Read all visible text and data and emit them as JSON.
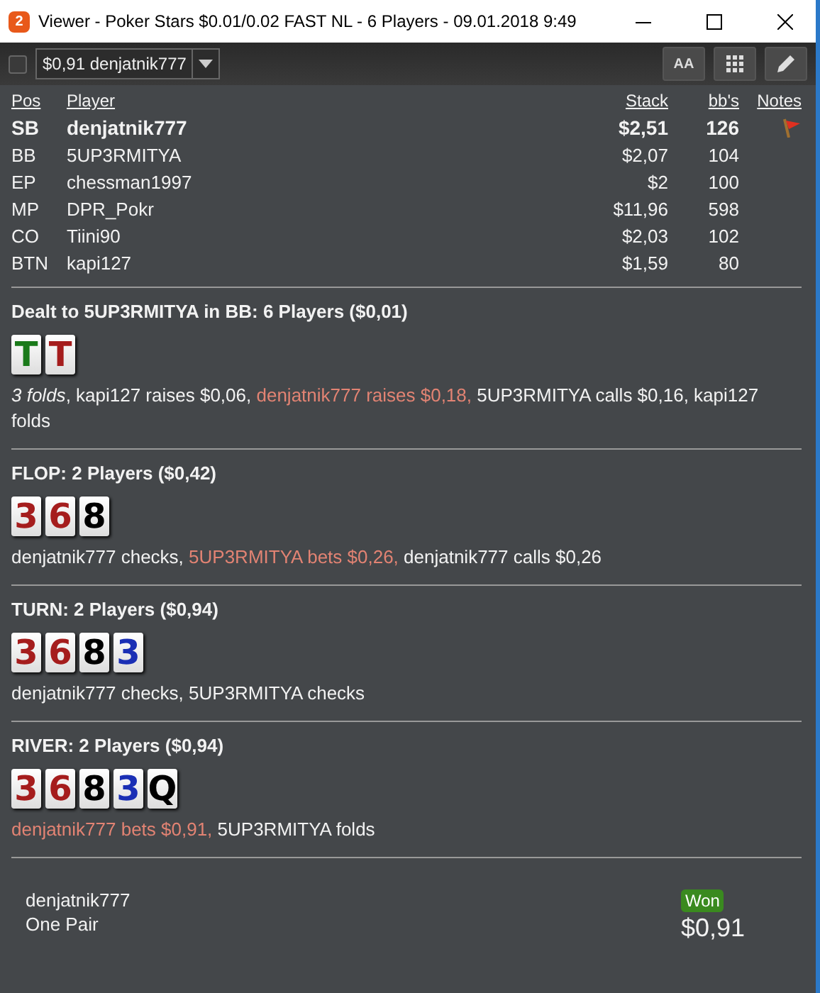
{
  "window": {
    "title": "Viewer - Poker Stars $0.01/0.02 FAST NL - 6 Players - 09.01.2018 9:49",
    "app_badge": "2"
  },
  "toolbar": {
    "checkbox": {
      "checked": false
    },
    "hand_select": {
      "value": "$0,91 denjatnik777"
    },
    "font_button": "AA"
  },
  "players": {
    "columns": [
      "Pos",
      "Player",
      "Stack",
      "bb's",
      "Notes"
    ],
    "rows": [
      {
        "pos": "SB",
        "player": "denjatnik777",
        "stack": "$2,51",
        "bbs": "126",
        "hero": true,
        "note": true
      },
      {
        "pos": "BB",
        "player": "5UP3RMITYA",
        "stack": "$2,07",
        "bbs": "104",
        "hero": false,
        "note": false
      },
      {
        "pos": "EP",
        "player": "chessman1997",
        "stack": "$2",
        "bbs": "100",
        "hero": false,
        "note": false
      },
      {
        "pos": "MP",
        "player": "DPR_Pokr",
        "stack": "$11,96",
        "bbs": "598",
        "hero": false,
        "note": false
      },
      {
        "pos": "CO",
        "player": "Tiini90",
        "stack": "$2,03",
        "bbs": "102",
        "hero": false,
        "note": false
      },
      {
        "pos": "BTN",
        "player": "kapi127",
        "stack": "$1,59",
        "bbs": "80",
        "hero": false,
        "note": false
      }
    ]
  },
  "streets": [
    {
      "title": "Dealt to 5UP3RMITYA in BB: 6 Players ($0,01)",
      "cards": [
        {
          "rank": "T",
          "color": "#1a7a1a"
        },
        {
          "rank": "T",
          "color": "#a51d1d"
        }
      ],
      "actions": [
        {
          "kind": "summary",
          "text": "3 folds"
        },
        {
          "kind": "plain",
          "text": ", kapi127 raises $0,06, "
        },
        {
          "kind": "hero",
          "text": "denjatnik777 raises $0,18,"
        },
        {
          "kind": "plain",
          "text": " 5UP3RMITYA calls $0,16, kapi127 folds"
        }
      ]
    },
    {
      "title": "FLOP: 2 Players ($0,42)",
      "cards": [
        {
          "rank": "3",
          "color": "#a51d1d"
        },
        {
          "rank": "6",
          "color": "#a51d1d"
        },
        {
          "rank": "8",
          "color": "#000000"
        }
      ],
      "actions": [
        {
          "kind": "plain",
          "text": "denjatnik777 checks, "
        },
        {
          "kind": "hero",
          "text": "5UP3RMITYA bets $0,26,"
        },
        {
          "kind": "plain",
          "text": " denjatnik777 calls $0,26"
        }
      ]
    },
    {
      "title": "TURN: 2 Players ($0,94)",
      "cards": [
        {
          "rank": "3",
          "color": "#a51d1d"
        },
        {
          "rank": "6",
          "color": "#a51d1d"
        },
        {
          "rank": "8",
          "color": "#000000"
        },
        {
          "rank": "3",
          "color": "#1a2fb5"
        }
      ],
      "actions": [
        {
          "kind": "plain",
          "text": "denjatnik777 checks, 5UP3RMITYA checks"
        }
      ]
    },
    {
      "title": "RIVER: 2 Players ($0,94)",
      "cards": [
        {
          "rank": "3",
          "color": "#a51d1d"
        },
        {
          "rank": "6",
          "color": "#a51d1d"
        },
        {
          "rank": "8",
          "color": "#000000"
        },
        {
          "rank": "3",
          "color": "#1a2fb5"
        },
        {
          "rank": "Q",
          "color": "#000000"
        }
      ],
      "actions": [
        {
          "kind": "hero",
          "text": "denjatnik777 bets $0,91,"
        },
        {
          "kind": "plain",
          "text": " 5UP3RMITYA folds"
        }
      ]
    }
  ],
  "result": {
    "player": "denjatnik777",
    "hand": "One Pair",
    "badge": "Won",
    "amount": "$0,91"
  }
}
